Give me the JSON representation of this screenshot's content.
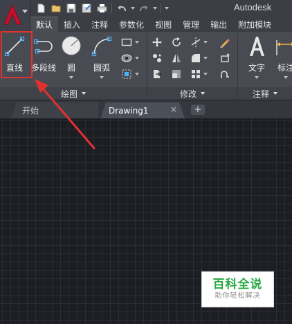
{
  "app": {
    "title": "Autodesk"
  },
  "ribbon_tabs": [
    "默认",
    "插入",
    "注释",
    "参数化",
    "视图",
    "管理",
    "输出",
    "附加模块"
  ],
  "panels": {
    "draw": {
      "title": "绘图",
      "tools": {
        "line": "直线",
        "polyline": "多段线",
        "circle": "圆",
        "arc": "圆弧"
      }
    },
    "modify": {
      "title": "修改"
    },
    "annotation": {
      "title": "注释",
      "tools": {
        "text": "文字",
        "dimension": "标注"
      }
    }
  },
  "file_tabs": {
    "start": "开始",
    "drawing": "Drawing1",
    "close": "×",
    "add": "+"
  },
  "watermark": {
    "main": "百科全说",
    "sub": "助你轻松解决"
  },
  "colors": {
    "highlight": "#e0312f",
    "accent_red": "#c8102e",
    "watermark_green": "#27a844"
  }
}
